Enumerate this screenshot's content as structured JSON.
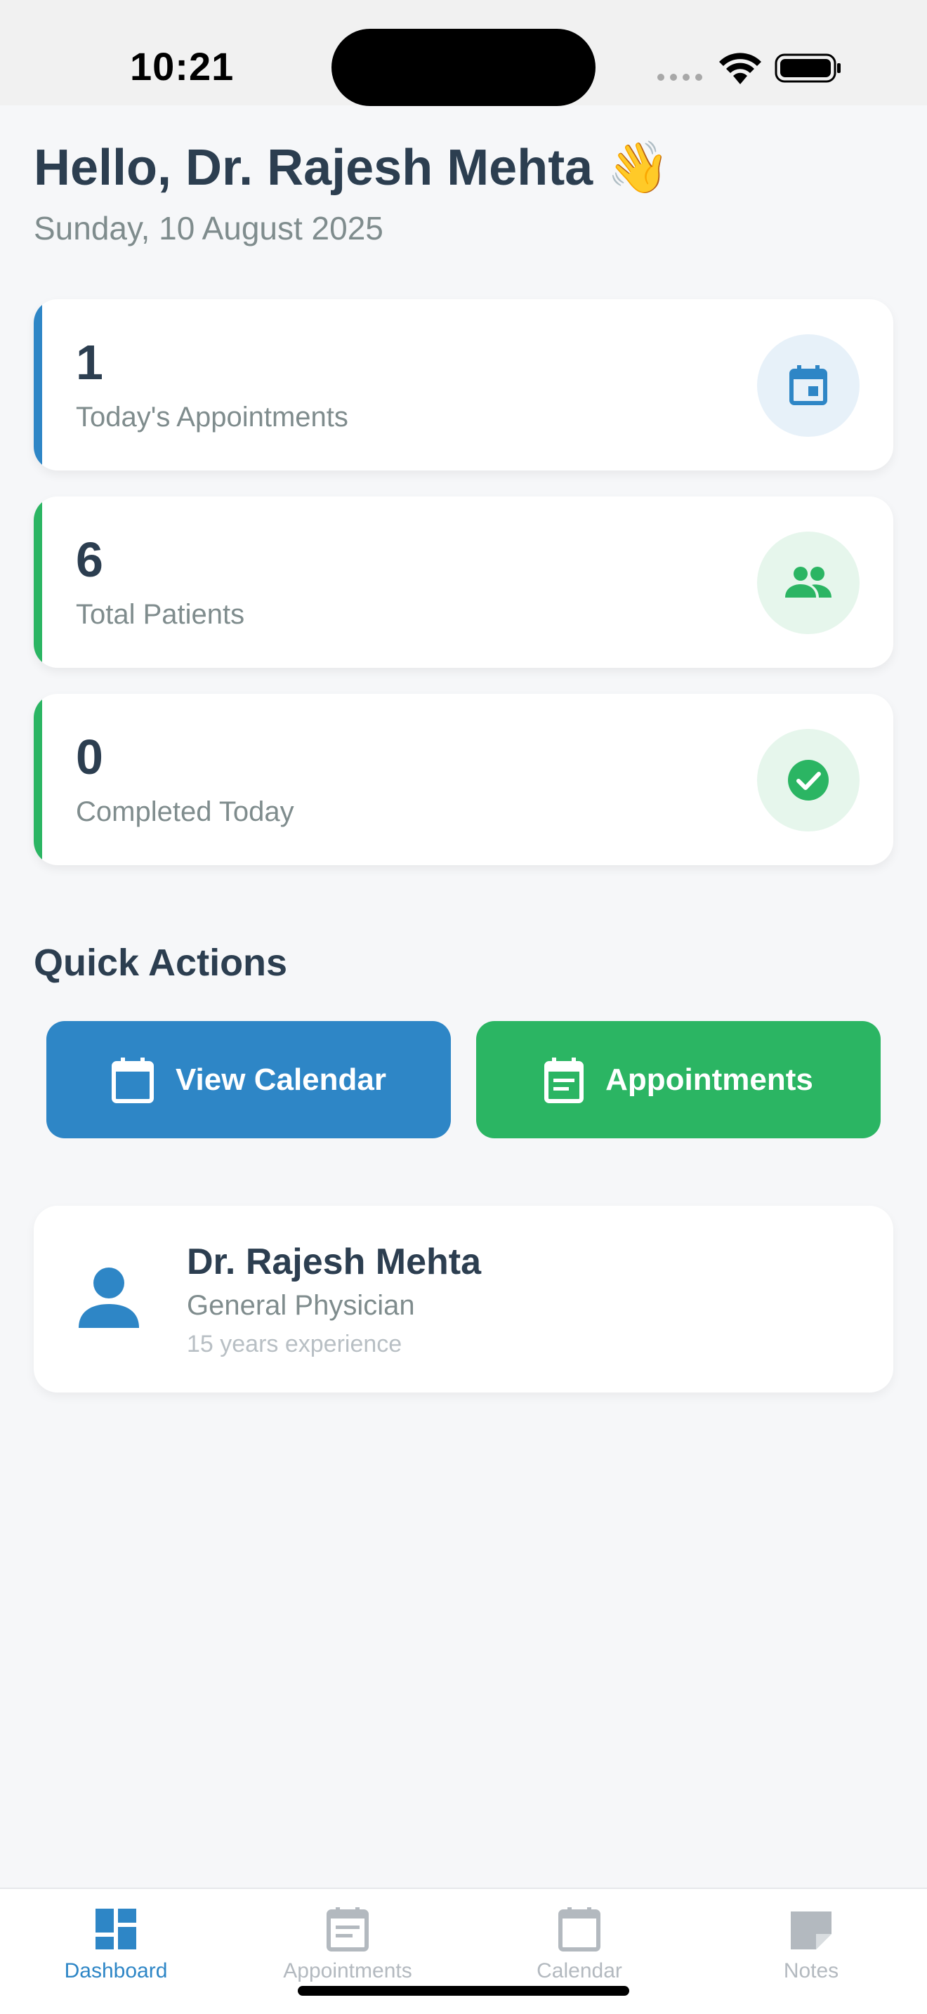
{
  "status_bar": {
    "time": "10:21",
    "icons": [
      "signal-icon",
      "wifi-icon",
      "battery-icon"
    ]
  },
  "header": {
    "greeting": "Hello, Dr. Rajesh Mehta 👋",
    "date": "Sunday, 10 August 2025"
  },
  "stats": [
    {
      "value": "1",
      "label": "Today's Appointments",
      "icon": "calendar-icon",
      "color": "#2e86c6",
      "icon_bg": "#e7f1f9"
    },
    {
      "value": "6",
      "label": "Total Patients",
      "icon": "people-icon",
      "color": "#2bb563",
      "icon_bg": "#e6f6ec"
    },
    {
      "value": "0",
      "label": "Completed Today",
      "icon": "check-circle-icon",
      "color": "#2bb563",
      "icon_bg": "#e6f6ec"
    }
  ],
  "quick_actions": {
    "title": "Quick Actions",
    "view_calendar": "View Calendar",
    "appointments": "Appointments"
  },
  "profile": {
    "name": "Dr. Rajesh Mehta",
    "specialty": "General Physician",
    "experience": "15 years experience"
  },
  "tabs": [
    {
      "label": "Dashboard",
      "icon": "dashboard-icon",
      "active": true
    },
    {
      "label": "Appointments",
      "icon": "list-icon",
      "active": false
    },
    {
      "label": "Calendar",
      "icon": "calendar-icon",
      "active": false
    },
    {
      "label": "Notes",
      "icon": "note-icon",
      "active": false
    }
  ],
  "colors": {
    "primary": "#2e86c6",
    "success": "#2bb563",
    "text_dark": "#2c3e50",
    "text_muted": "#7f8c8d",
    "tab_inactive": "#b3b9bf"
  }
}
